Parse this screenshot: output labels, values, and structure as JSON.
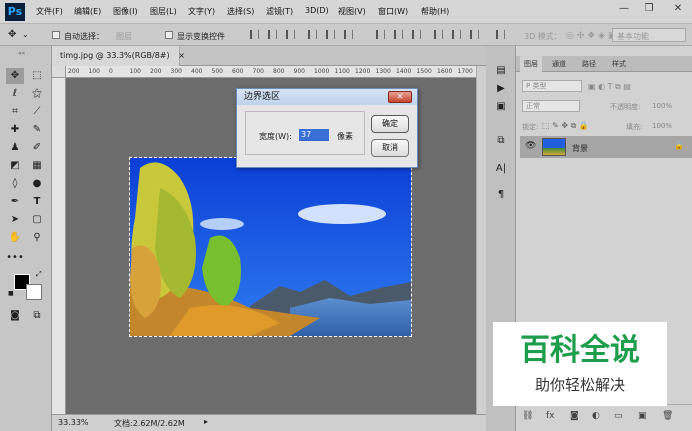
{
  "app": {
    "logo": "Ps"
  },
  "menubar": {
    "items": [
      "文件(F)",
      "编辑(E)",
      "图像(I)",
      "图层(L)",
      "文字(Y)",
      "选择(S)",
      "滤镜(T)",
      "3D(D)",
      "视图(V)",
      "窗口(W)",
      "帮助(H)"
    ],
    "minimize": "—",
    "restore": "❐",
    "close": "✕"
  },
  "optbar": {
    "auto_select": "自动选择：",
    "auto_select_value": "图层",
    "show_transform": "显示变换控件",
    "mode_3d": "3D 模式：",
    "workspace": "基本功能"
  },
  "document": {
    "tab_title": "timg.jpg @ 33.3%(RGB/8#)",
    "tab_close": "×",
    "ruler_ticks": [
      "200",
      "100",
      "0",
      "100",
      "200",
      "300",
      "400",
      "500",
      "600",
      "700",
      "800",
      "900",
      "1000",
      "1100",
      "1200",
      "1300",
      "1400",
      "1500",
      "1600",
      "1700"
    ],
    "zoom": "33.33%",
    "doc_info": "文档:2.62M/2.62M"
  },
  "dialog": {
    "title": "边界选区",
    "width_label": "宽度(W):",
    "width_value": "37",
    "unit": "像素",
    "ok": "确定",
    "cancel": "取消"
  },
  "layers_panel": {
    "tabs": [
      "图层",
      "通道",
      "路径",
      "样式"
    ],
    "filter_kind": "P 类型",
    "blend_mode": "正常",
    "opacity_label": "不透明度:",
    "opacity_value": "100%",
    "lock_label": "锁定:",
    "fill_label": "填充:",
    "fill_value": "100%",
    "layer_name": "背景"
  },
  "watermark": {
    "title": "百科全说",
    "subtitle": "助你轻松解决"
  },
  "colors": {
    "watermark_green": "#1e9e4c",
    "dialog_title_bg": "#c0d3ec",
    "canvas_bg": "#6d6d6d"
  }
}
